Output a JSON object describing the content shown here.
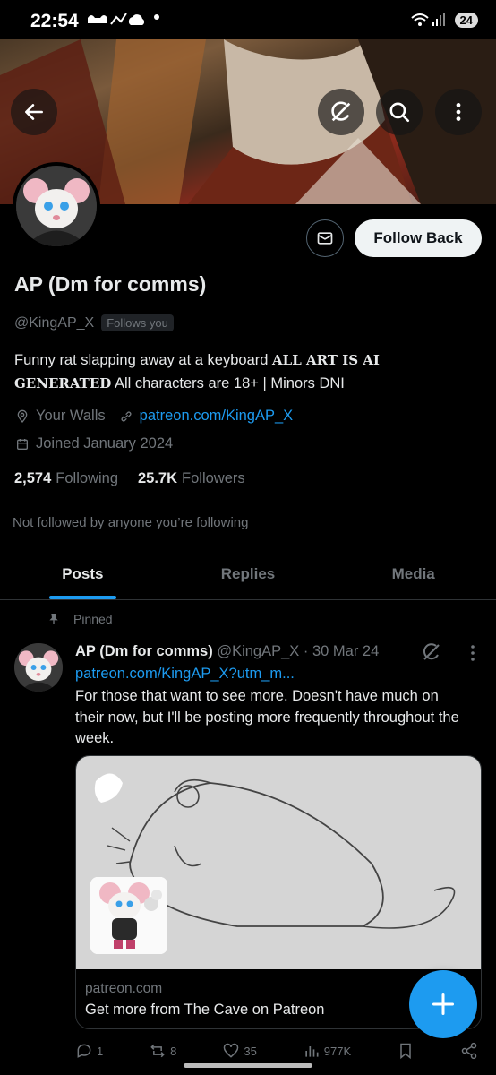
{
  "status_bar": {
    "time": "22:54",
    "battery": "24"
  },
  "profile": {
    "display_name": "AP (Dm for comms)",
    "handle": "@KingAP_X",
    "follows_you": "Follows you",
    "follow_button": "Follow Back",
    "bio_plain_1": "Funny rat slapping away at a keyboard ",
    "bio_bold": "ALL ART IS AI GENERATED",
    "bio_plain_2": " All characters are 18+ | Minors DNI",
    "location": "Your Walls",
    "website": "patreon.com/KingAP_X",
    "joined": "Joined January 2024",
    "following_count": "2,574",
    "following_label": "Following",
    "followers_count": "25.7K",
    "followers_label": "Followers",
    "not_followed_text": "Not followed by anyone you’re following"
  },
  "tabs": [
    {
      "label": "Posts",
      "active": true
    },
    {
      "label": "Replies",
      "active": false
    },
    {
      "label": "Media",
      "active": false
    }
  ],
  "post": {
    "pinned_label": "Pinned",
    "author_name": "AP (Dm for comms)",
    "author_handle": "@KingAP_X",
    "date": "30 Mar 24",
    "link": "patreon.com/KingAP_X?utm_m...",
    "text": "For those that want to see more. Doesn't have much on their now, but I'll be posting more frequently throughout the week.",
    "card_domain": "patreon.com",
    "card_title": "Get more from The Cave on Patreon",
    "replies": "1",
    "reposts": "8",
    "likes": "35",
    "views": "977K"
  },
  "colors": {
    "accent": "#1d9bf0",
    "background": "#000000",
    "text": "#e7e9ea",
    "muted": "#71767b"
  },
  "icons": [
    "back-arrow-icon",
    "grok-icon",
    "search-icon",
    "more-vertical-icon",
    "mail-icon",
    "location-icon",
    "link-icon",
    "calendar-icon",
    "pin-icon",
    "reply-icon",
    "repost-icon",
    "like-icon",
    "views-icon",
    "bookmark-icon",
    "share-icon",
    "plus-icon"
  ]
}
